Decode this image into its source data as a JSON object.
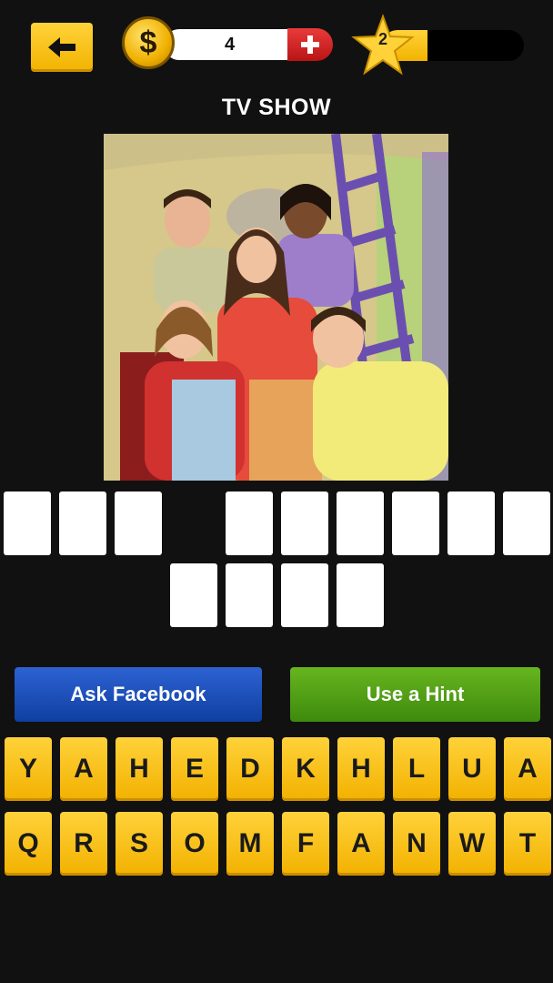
{
  "header": {
    "back_icon": "left-arrow-icon",
    "coin_symbol": "$",
    "coins": "4",
    "add_coins_icon": "plus-icon",
    "level": "2",
    "level_progress": 0.32
  },
  "category": "TV SHOW",
  "photo": {
    "icon": "tv-show-cast-photo"
  },
  "answer": {
    "row1_slots": 9,
    "row2_slots": 4
  },
  "buttons": {
    "ask_facebook": "Ask Facebook",
    "use_hint": "Use a Hint"
  },
  "keyboard": {
    "row1": [
      "Y",
      "A",
      "H",
      "E",
      "D",
      "K",
      "H",
      "L",
      "U",
      "A"
    ],
    "row2": [
      "Q",
      "R",
      "S",
      "O",
      "M",
      "F",
      "A",
      "N",
      "W",
      "T"
    ]
  },
  "colors": {
    "accent_yellow": "#f2b300",
    "facebook_blue": "#1a4fc0",
    "hint_green": "#4f9d14",
    "plus_red": "#d42424"
  }
}
